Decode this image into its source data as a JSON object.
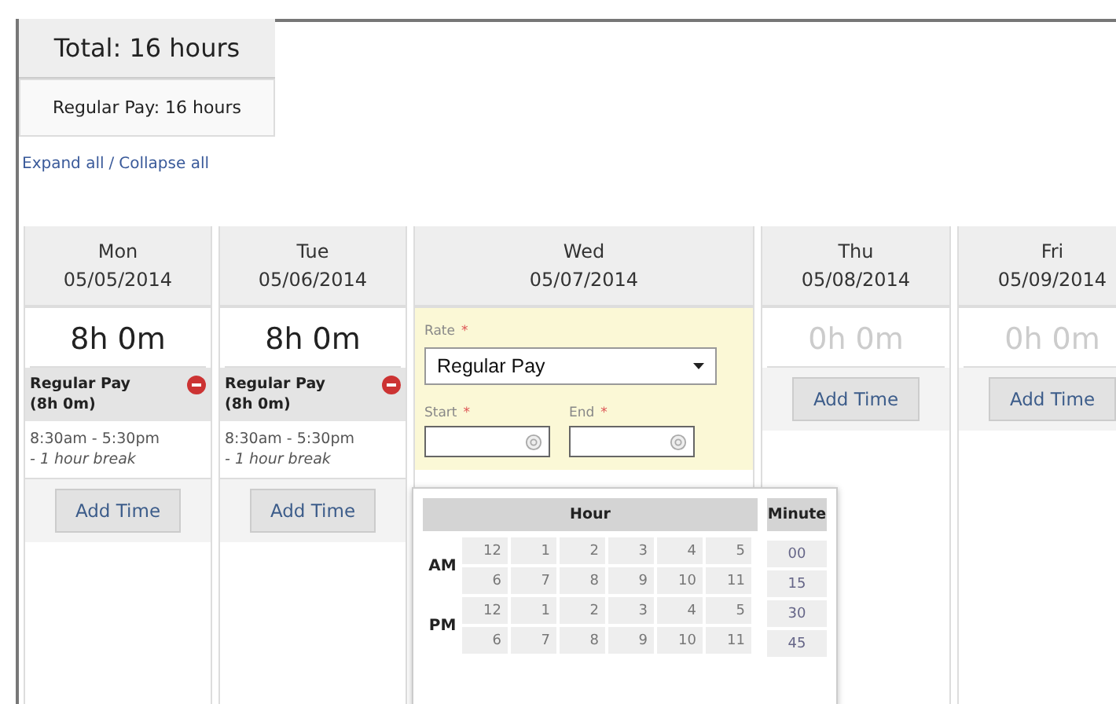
{
  "summary": {
    "total": "Total: 16 hours",
    "lines": [
      "Regular Pay: 16 hours"
    ]
  },
  "links": {
    "expand": "Expand all",
    "separator": "/",
    "collapse": "Collapse all"
  },
  "days": [
    {
      "kind": "entries",
      "day": "Mon",
      "date": "05/05/2014",
      "hours": "8h 0m",
      "zero": false,
      "entries": [
        {
          "rate": "Regular Pay",
          "duration": "(8h 0m)",
          "time": "8:30am - 5:30pm",
          "break": "- 1 hour break"
        }
      ],
      "add": "Add Time"
    },
    {
      "kind": "entries",
      "day": "Tue",
      "date": "05/06/2014",
      "hours": "8h 0m",
      "zero": false,
      "entries": [
        {
          "rate": "Regular Pay",
          "duration": "(8h 0m)",
          "time": "8:30am - 5:30pm",
          "break": "- 1 hour break"
        }
      ],
      "add": "Add Time"
    },
    {
      "kind": "editing",
      "day": "Wed",
      "date": "05/07/2014",
      "form": {
        "rate_label": "Rate",
        "rate_value": "Regular Pay",
        "start_label": "Start",
        "end_label": "End",
        "required": "*"
      }
    },
    {
      "kind": "entries",
      "day": "Thu",
      "date": "05/08/2014",
      "hours": "0h 0m",
      "zero": true,
      "add": "Add Time"
    },
    {
      "kind": "entries",
      "day": "Fri",
      "date": "05/09/2014",
      "hours": "0h 0m",
      "zero": true,
      "add": "Add Time"
    }
  ],
  "time_picker": {
    "hour_title": "Hour",
    "minute_title": "Minute",
    "periods": [
      {
        "label": "AM",
        "rows": [
          [
            "12",
            "1",
            "2",
            "3",
            "4",
            "5"
          ],
          [
            "6",
            "7",
            "8",
            "9",
            "10",
            "11"
          ]
        ]
      },
      {
        "label": "PM",
        "rows": [
          [
            "12",
            "1",
            "2",
            "3",
            "4",
            "5"
          ],
          [
            "6",
            "7",
            "8",
            "9",
            "10",
            "11"
          ]
        ]
      }
    ],
    "minutes": [
      "00",
      "15",
      "30",
      "45"
    ]
  }
}
